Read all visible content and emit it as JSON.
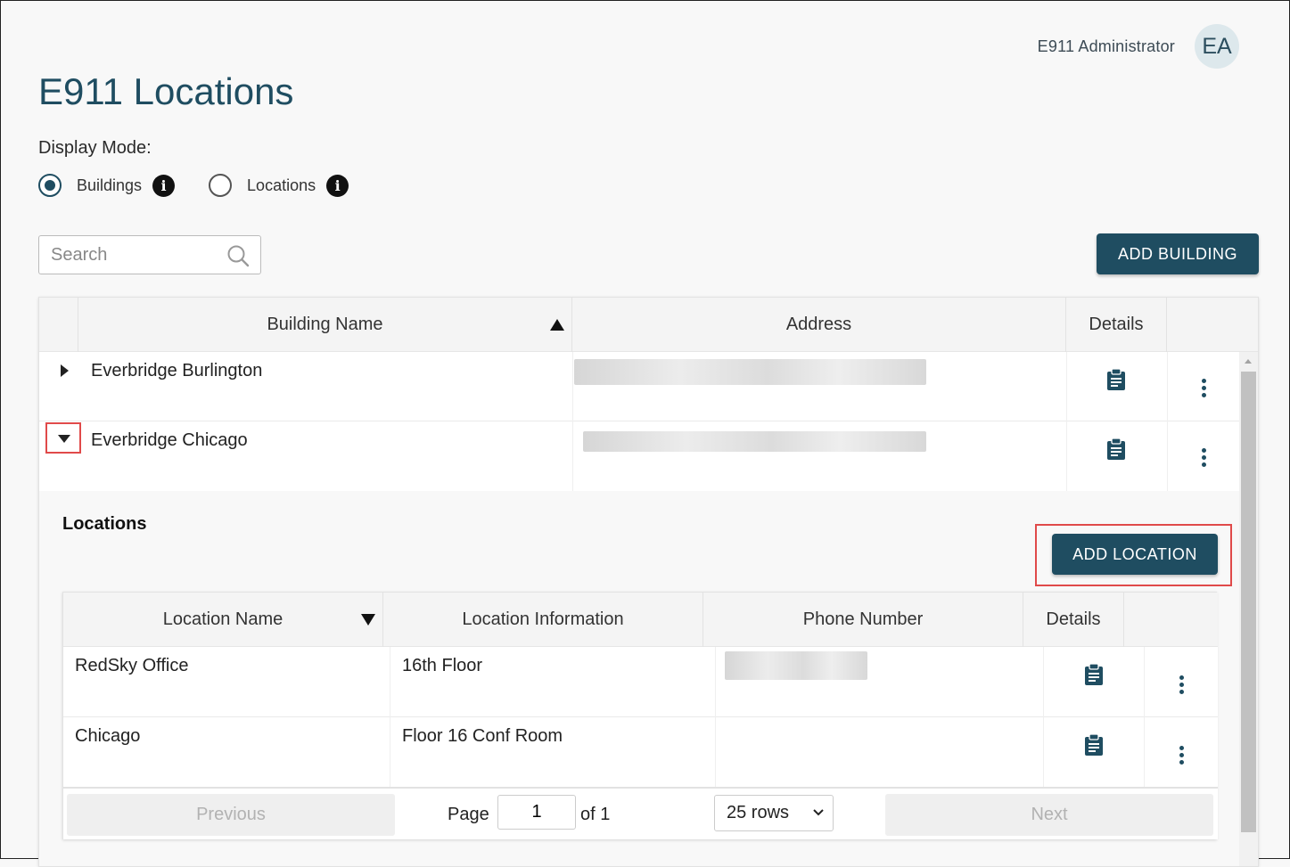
{
  "user": {
    "name": "E911 Administrator",
    "initials": "EA"
  },
  "page": {
    "title": "E911 Locations"
  },
  "display_mode": {
    "label": "Display Mode:",
    "options": [
      {
        "label": "Buildings",
        "selected": true
      },
      {
        "label": "Locations",
        "selected": false
      }
    ]
  },
  "search": {
    "placeholder": "Search",
    "value": ""
  },
  "toolbar": {
    "add_building_label": "ADD BUILDING"
  },
  "buildings_table": {
    "columns": [
      "Building Name",
      "Address",
      "Details"
    ],
    "sort": {
      "column": "Building Name",
      "direction": "ascending"
    },
    "rows": [
      {
        "name": "Everbridge Burlington",
        "expanded": false
      },
      {
        "name": "Everbridge Chicago",
        "expanded": true
      }
    ]
  },
  "locations_panel": {
    "heading": "Locations",
    "add_location_label": "ADD LOCATION",
    "columns": [
      "Location Name",
      "Location Information",
      "Phone Number",
      "Details"
    ],
    "sort": {
      "column": "Location Name",
      "direction": "descending"
    },
    "rows": [
      {
        "name": "RedSky Office",
        "info": "16th Floor"
      },
      {
        "name": "Chicago",
        "info": "Floor 16 Conf Room"
      }
    ],
    "pager": {
      "previous_label": "Previous",
      "next_label": "Next",
      "page_label": "Page",
      "page_value": "1",
      "of_label": "of 1",
      "rows_option": "25 rows"
    }
  },
  "colors": {
    "accent": "#1f4d61",
    "highlight": "#e04a4a",
    "avatar_bg": "#dde8ec"
  },
  "icons": [
    "search-icon",
    "info-icon",
    "clipboard-icon",
    "kebab-icon",
    "caret-right-icon",
    "caret-down-icon",
    "chevron-down-icon"
  ]
}
